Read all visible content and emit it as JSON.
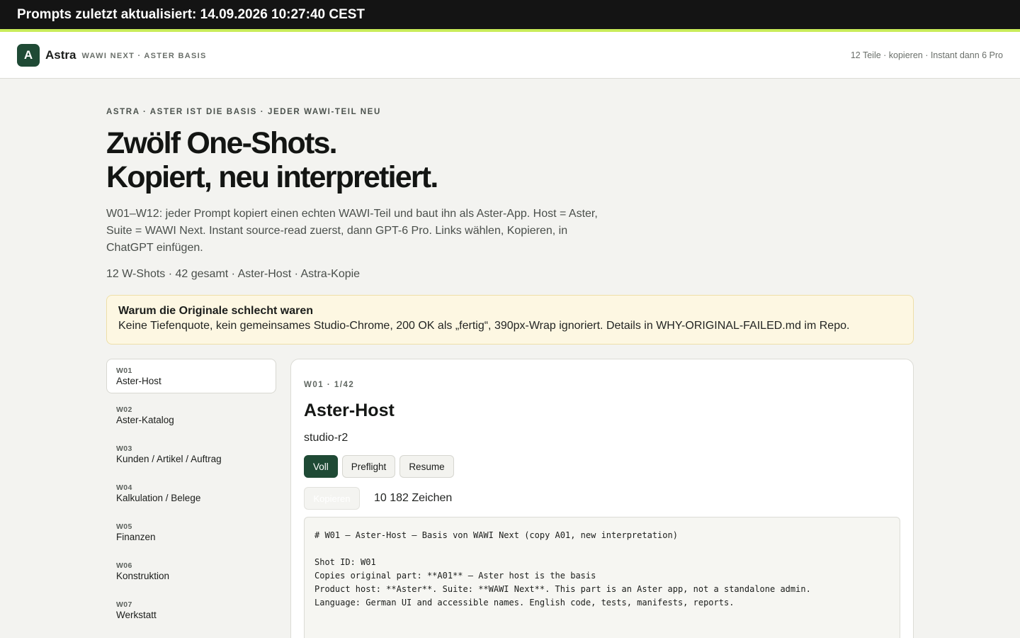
{
  "topbar": {
    "text": "Prompts zuletzt aktualisiert: 14.09.2026 10:27:40 CEST"
  },
  "header": {
    "logo_letter": "A",
    "brand": "Astra",
    "subtitle": "WAWI NEXT · ASTER BASIS",
    "meta": "12 Teile · kopieren · Instant dann 6 Pro"
  },
  "hero": {
    "eyebrow": "ASTRA · ASTER IST DIE BASIS · JEDER WAWI-TEIL NEU",
    "title_line1": "Zwölf One-Shots.",
    "title_line2": "Kopiert, neu interpretiert.",
    "lead": "W01–W12: jeder Prompt kopiert einen echten WAWI-Teil und baut ihn als Aster-App. Host = Aster, Suite = WAWI Next. Instant source-read zuerst, dann GPT-6 Pro. Links wählen, Kopieren, in ChatGPT einfügen.",
    "stats": "12 W-Shots · 42 gesamt · Aster-Host · Astra-Kopie"
  },
  "notice": {
    "title": "Warum die Originale schlecht waren",
    "text": "Keine Tiefenquote, kein gemeinsames Studio-Chrome, 200 OK als „fertig“, 390px-Wrap ignoriert. Details in WHY-ORIGINAL-FAILED.md im Repo."
  },
  "sidebar": {
    "items": [
      {
        "code": "W01",
        "label": "Aster-Host",
        "active": true
      },
      {
        "code": "W02",
        "label": "Aster-Katalog"
      },
      {
        "code": "W03",
        "label": "Kunden / Artikel / Auftrag"
      },
      {
        "code": "W04",
        "label": "Kalkulation / Belege"
      },
      {
        "code": "W05",
        "label": "Finanzen"
      },
      {
        "code": "W06",
        "label": "Konstruktion"
      },
      {
        "code": "W07",
        "label": "Werkstatt"
      }
    ]
  },
  "panel": {
    "meta": "W01 · 1/42",
    "title": "Aster-Host",
    "subtitle": "studio-r2",
    "modes": [
      "Voll",
      "Preflight",
      "Resume"
    ],
    "active_mode": "Voll",
    "copy_label": "Kopieren",
    "chars": "10 182 Zeichen",
    "code_lines": [
      "# W01 — Aster-Host — Basis von WAWI Next (copy A01, new interpretation)",
      "",
      "Shot ID: W01",
      "Copies original part: **A01** — Aster host is the basis",
      "Product host: **Aster**. Suite: **WAWI Next**. This part is an Aster app, not a standalone admin.",
      "Language: German UI and accessible names. English code, tests, manifests, reports."
    ]
  },
  "colors": {
    "accent": "#1f4a35",
    "topbar_bg": "#141414",
    "topbar_stripe": "#c9ec5a",
    "notice_bg": "#fdf7e2"
  }
}
